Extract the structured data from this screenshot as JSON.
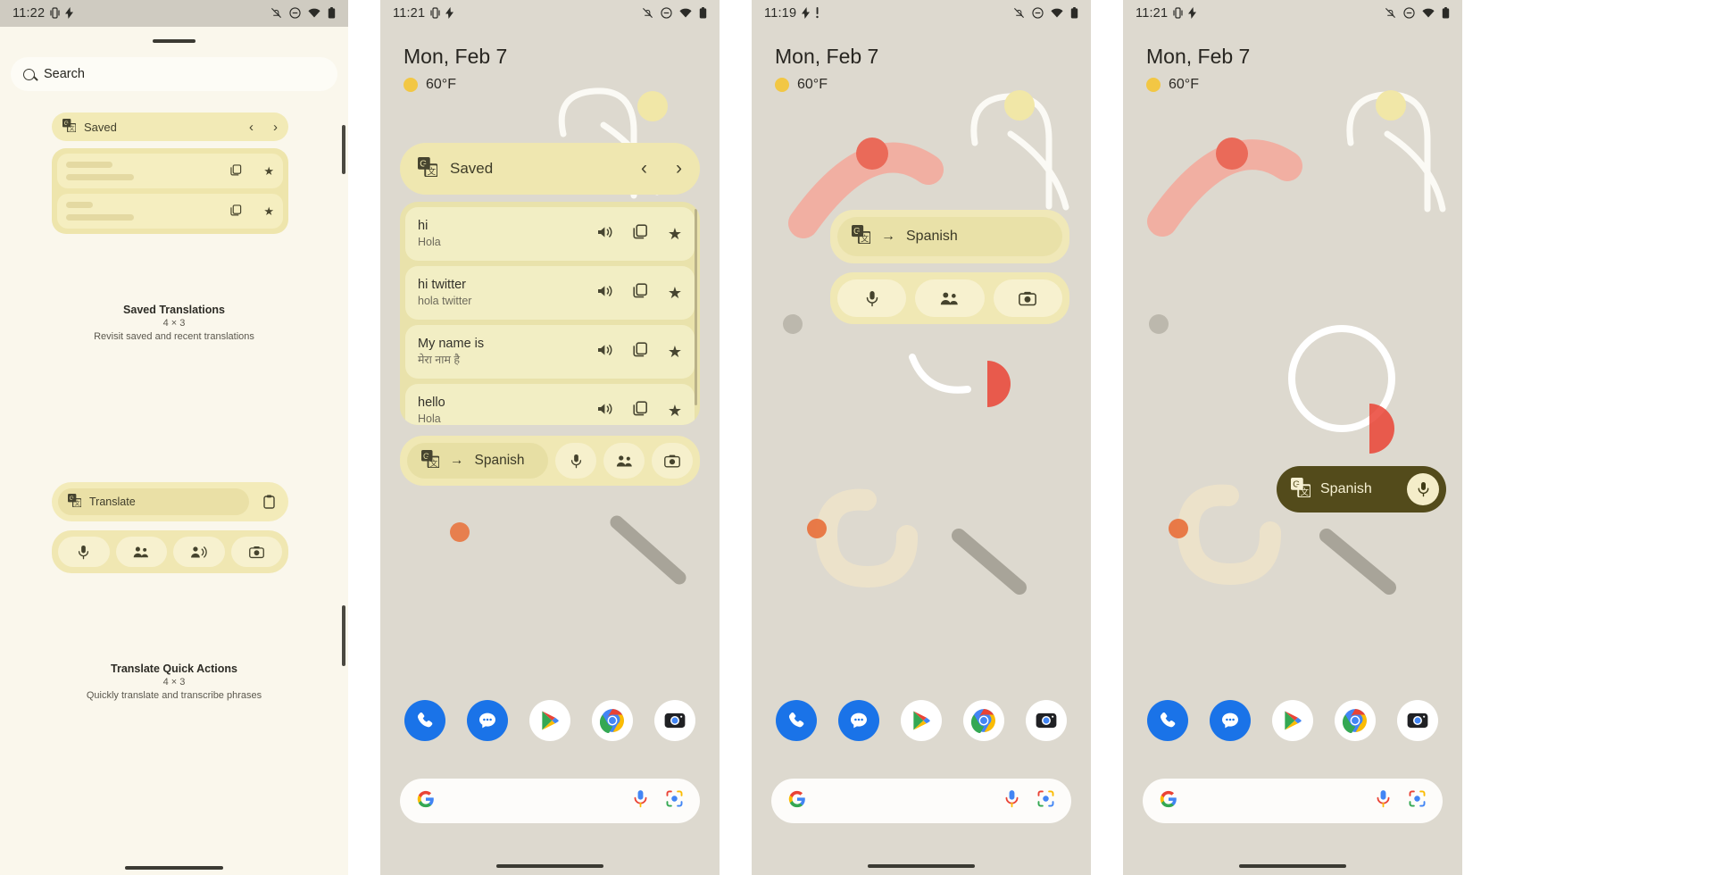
{
  "panels": [
    {
      "id": "widget-picker",
      "status": {
        "time": "11:22",
        "icons": [
          "vibrate-icon",
          "bolt-icon"
        ],
        "right_icons": [
          "notification-off-icon",
          "dnd-icon",
          "wifi-icon",
          "battery-icon"
        ]
      },
      "search": {
        "placeholder": "Search",
        "icon": "search-icon"
      },
      "preview_widget": {
        "header_label": "Saved",
        "header_icon": "google-translate-icon",
        "prev_icon": "chevron-left-icon",
        "next_icon": "chevron-right-icon",
        "rows": [
          {
            "copy_icon": "copy-icon",
            "star_icon": "star-icon"
          },
          {
            "copy_icon": "copy-icon",
            "star_icon": "star-icon"
          }
        ]
      },
      "widget_label_1": {
        "title": "Saved Translations",
        "dimensions": "4 × 3",
        "description": "Revisit saved and recent translations"
      },
      "quick_actions_widget": {
        "pill_label": "Translate",
        "pill_icon": "google-translate-icon",
        "clipboard_icon": "clipboard-icon",
        "buttons": [
          "mic-icon",
          "conversation-icon",
          "transcribe-icon",
          "camera-icon"
        ]
      },
      "widget_label_2": {
        "title": "Translate Quick Actions",
        "dimensions": "4 × 3",
        "description": "Quickly translate and transcribe phrases"
      }
    },
    {
      "id": "home-saved-translations",
      "status": {
        "time": "11:21",
        "icons": [
          "vibrate-icon",
          "bolt-icon"
        ],
        "right_icons": [
          "notification-off-icon",
          "dnd-icon",
          "wifi-icon",
          "battery-icon"
        ]
      },
      "date": "Mon, Feb 7",
      "temperature": "60°F",
      "weather_icon": "sun-icon",
      "widget": {
        "header_label": "Saved",
        "header_icon": "google-translate-icon",
        "prev_icon": "chevron-left-icon",
        "next_icon": "chevron-right-icon",
        "translations": [
          {
            "source": "hi",
            "target": "Hola",
            "speak_icon": "volume-icon",
            "copy_icon": "copy-icon",
            "star_icon": "star-icon"
          },
          {
            "source": "hi twitter",
            "target": "hola twitter",
            "speak_icon": "volume-icon",
            "copy_icon": "copy-icon",
            "star_icon": "star-icon"
          },
          {
            "source": "My name is",
            "target": "मेरा नाम है",
            "speak_icon": "volume-icon",
            "copy_icon": "copy-icon",
            "star_icon": "star-icon"
          },
          {
            "source": "hello",
            "target": "Hola",
            "speak_icon": "volume-icon",
            "copy_icon": "copy-icon",
            "star_icon": "star-icon"
          }
        ],
        "language_pill": {
          "icon": "google-translate-icon",
          "arrow": "→",
          "label": "Spanish"
        },
        "action_buttons": [
          "mic-icon",
          "conversation-icon",
          "camera-icon"
        ]
      },
      "dock": [
        "phone-icon",
        "messages-icon",
        "play-store-icon",
        "chrome-icon",
        "camera-icon"
      ],
      "search": {
        "google_icon": "google-g-icon",
        "mic_icon": "mic-icon",
        "lens_icon": "google-lens-icon"
      }
    },
    {
      "id": "home-quick-actions",
      "status": {
        "time": "11:19",
        "icons": [
          "bolt-icon",
          "warning-icon"
        ],
        "right_icons": [
          "notification-off-icon",
          "dnd-icon",
          "wifi-icon",
          "battery-icon"
        ]
      },
      "date": "Mon, Feb 7",
      "temperature": "60°F",
      "weather_icon": "sun-icon",
      "widget": {
        "language_pill": {
          "icon": "google-translate-icon",
          "arrow": "→",
          "label": "Spanish"
        },
        "action_buttons": [
          "mic-icon",
          "conversation-icon",
          "camera-icon"
        ]
      },
      "dock": [
        "phone-icon",
        "messages-icon",
        "play-store-icon",
        "chrome-icon",
        "camera-icon"
      ],
      "search": {
        "google_icon": "google-g-icon",
        "mic_icon": "mic-icon",
        "lens_icon": "google-lens-icon"
      }
    },
    {
      "id": "home-compact-translate",
      "status": {
        "time": "11:21",
        "icons": [
          "vibrate-icon",
          "bolt-icon"
        ],
        "right_icons": [
          "notification-off-icon",
          "dnd-icon",
          "wifi-icon",
          "battery-icon"
        ]
      },
      "date": "Mon, Feb 7",
      "temperature": "60°F",
      "weather_icon": "sun-icon",
      "widget": {
        "icon": "google-translate-icon",
        "label": "Spanish",
        "mic_icon": "mic-icon"
      },
      "dock": [
        "phone-icon",
        "messages-icon",
        "play-store-icon",
        "chrome-icon",
        "camera-icon"
      ],
      "search": {
        "google_icon": "google-g-icon",
        "mic_icon": "mic-icon",
        "lens_icon": "google-lens-icon"
      }
    }
  ],
  "colors": {
    "home_bg": "#ddd9cf",
    "sheet_bg": "#faf7ec",
    "widget_yellow": "#f0e8b4",
    "widget_yellow_dark": "#e7dfa4",
    "dark_pill": "#534b1b",
    "accent_red": "#ea4335",
    "accent_blue": "#1a73e8"
  }
}
